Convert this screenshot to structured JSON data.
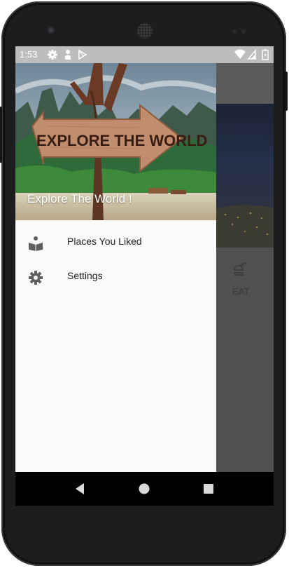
{
  "status_bar": {
    "time": "1:53",
    "icons": [
      "gear-icon",
      "person-icon",
      "play-store-icon",
      "wifi-icon",
      "signal-icon",
      "battery-icon"
    ]
  },
  "drawer": {
    "header_title": "Explore The World !",
    "header_image_caption": "EXPLORE THE WORLD",
    "items": [
      {
        "icon": "book-person-icon",
        "label": "Places You Liked"
      },
      {
        "icon": "gear-icon",
        "label": "Settings"
      }
    ]
  },
  "background_app": {
    "tab_label": "EAT",
    "tab_icon": "food-icon"
  },
  "navigation_bar": {
    "buttons": [
      "back-button",
      "home-button",
      "recents-button"
    ]
  },
  "colors": {
    "status_bar": "#bdbdbd",
    "scrim": "#505050",
    "drawer_bg": "#fafafa",
    "nav_bar": "#000000"
  }
}
